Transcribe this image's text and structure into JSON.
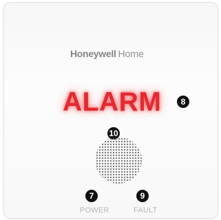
{
  "device": {
    "brand_bold": "Honeywell",
    "brand_light": "Home",
    "alarm_label": "ALARM",
    "power_label": "POWER",
    "fault_label": "FAULT",
    "callouts": {
      "alarm": "8",
      "speaker": "10",
      "power": "7",
      "fault": "9"
    },
    "colors": {
      "alarm": "#e02a32",
      "callout": "#111111",
      "label": "#b7b7b7"
    }
  }
}
